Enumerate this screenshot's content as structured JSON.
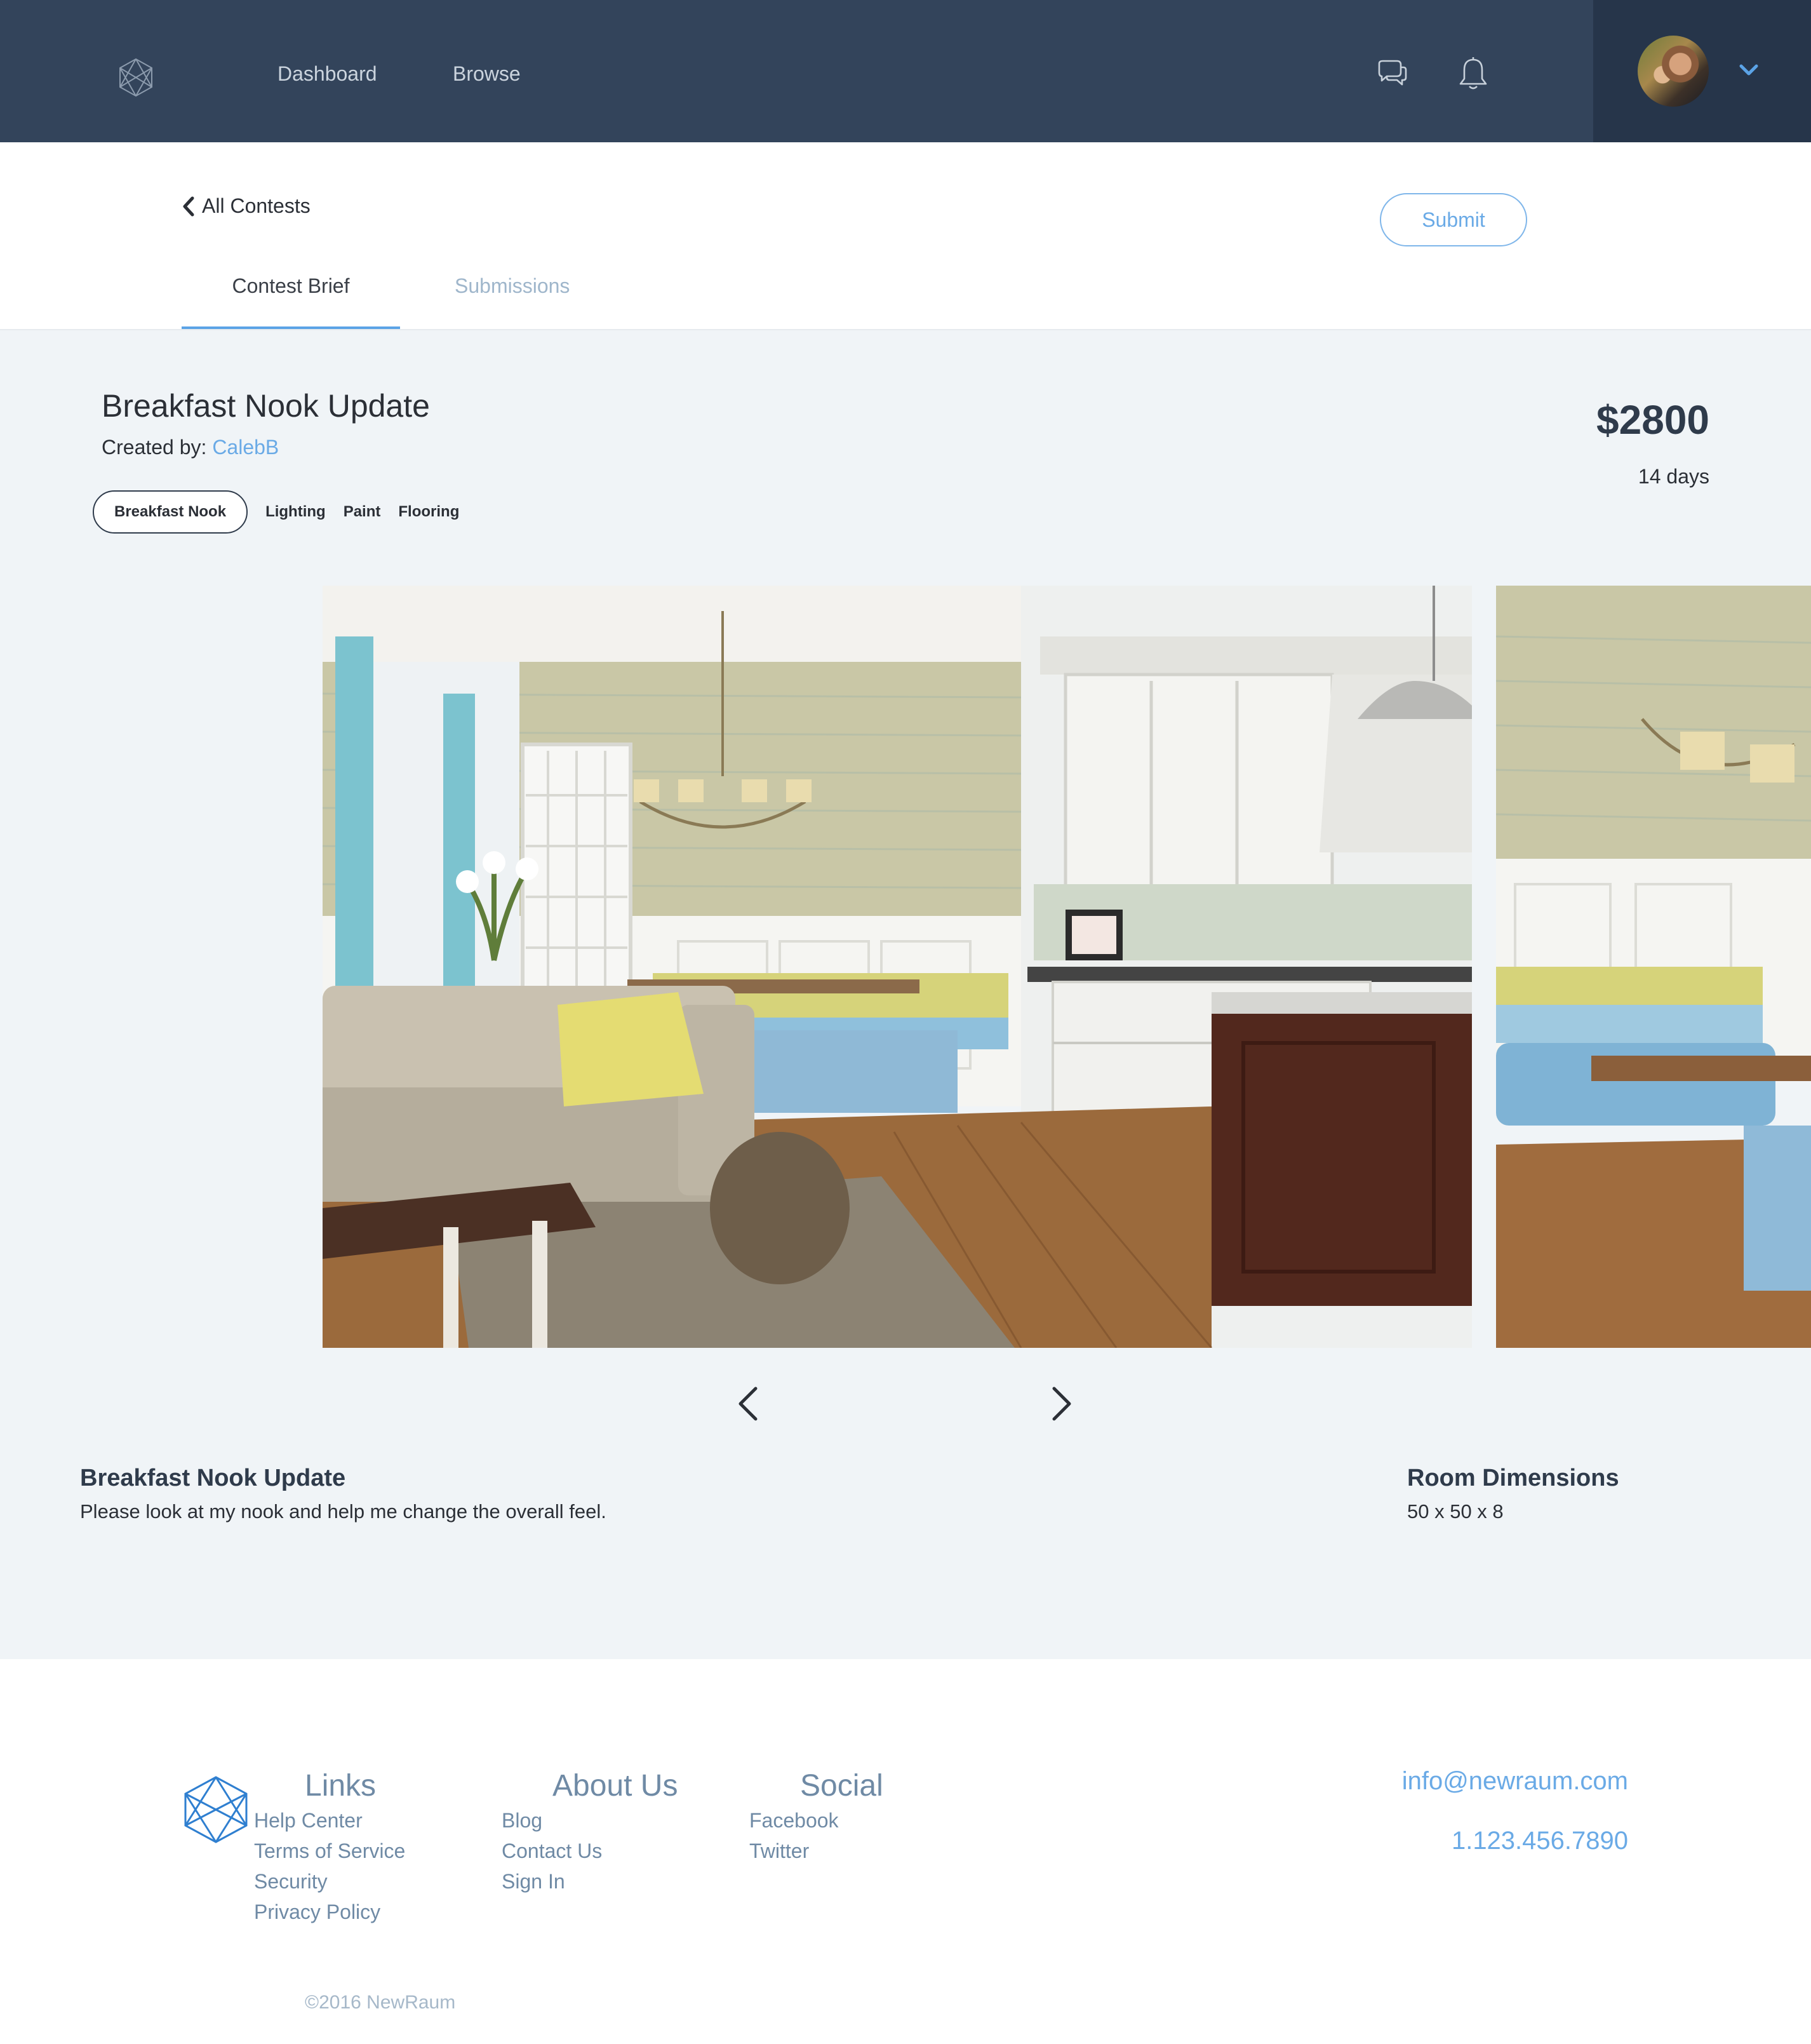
{
  "nav": {
    "items": [
      "Dashboard",
      "Browse"
    ],
    "icons": [
      "logo-icon",
      "chat-icon",
      "bell-icon",
      "chevron-down-icon"
    ],
    "accent": "#33445b"
  },
  "subheader": {
    "back_label": "All Contests",
    "submit_label": "Submit",
    "tabs": [
      "Contest Brief",
      "Submissions"
    ]
  },
  "contest": {
    "title": "Breakfast Nook Update",
    "created_by_label": "Created by:",
    "creator": "CalebB",
    "price": "$2800",
    "duration": "14 days",
    "tags": [
      "Breakfast Nook",
      "Lighting",
      "Paint",
      "Flooring"
    ],
    "description_title": "Breakfast Nook Update",
    "description": "Please look at my nook and help me change the overall feel.",
    "dimensions_title": "Room Dimensions",
    "dimensions": "50 x 50 x 8"
  },
  "footer": {
    "columns": [
      {
        "title": "Links",
        "items": [
          "Help Center",
          "Terms of Service",
          "Security",
          "Privacy Policy"
        ]
      },
      {
        "title": "About Us",
        "items": [
          "Blog",
          "Contact Us",
          "Sign In"
        ]
      },
      {
        "title": "Social",
        "items": [
          "Facebook",
          "Twitter"
        ]
      }
    ],
    "email": "info@newraum.com",
    "phone": "1.123.456.7890",
    "copyright": "©2016 NewRaum"
  },
  "colors": {
    "nav_bg": "#33445b",
    "user_panel_bg": "#26354a",
    "link_blue": "#6aaae6",
    "page_bg": "#f0f4f7"
  }
}
